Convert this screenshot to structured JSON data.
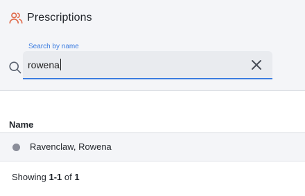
{
  "header": {
    "title": "Prescriptions",
    "icon": "users-icon",
    "icon_color": "#e06a4a"
  },
  "search": {
    "label": "Search by name",
    "value": "rowena",
    "accent": "#3b7ce0"
  },
  "table": {
    "columns": [
      "Name"
    ],
    "rows": [
      {
        "name": "Ravenclaw, Rowena",
        "status_color": "#8a8d99"
      }
    ]
  },
  "pagination": {
    "prefix": "Showing",
    "range": "1-1",
    "of": "of",
    "total": "1"
  }
}
